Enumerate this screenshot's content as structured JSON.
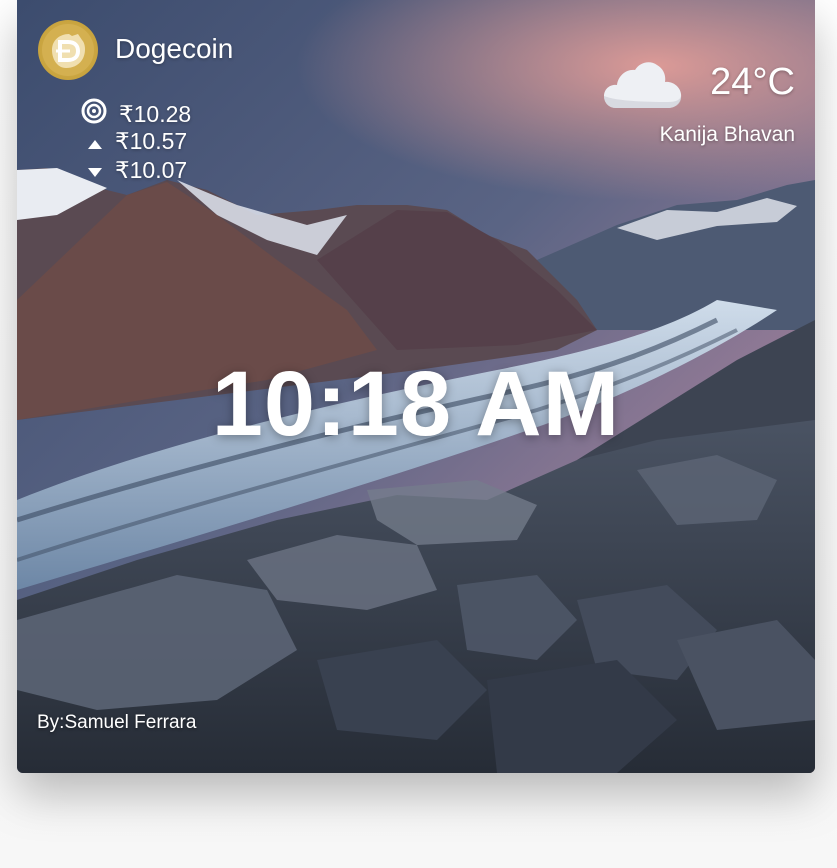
{
  "crypto": {
    "name": "Dogecoin",
    "icon": "dogecoin-logo-icon",
    "current_price": "₹10.28",
    "high_price": "₹10.57",
    "low_price": "₹10.07"
  },
  "weather": {
    "icon": "cloud-icon",
    "temperature": "24°C",
    "location": "Kanija Bhavan"
  },
  "clock": {
    "time": "10:18 AM"
  },
  "credit": {
    "text": "By:Samuel Ferrara"
  },
  "colors": {
    "text": "#ffffff",
    "coin_gold": "#c8a33e"
  }
}
